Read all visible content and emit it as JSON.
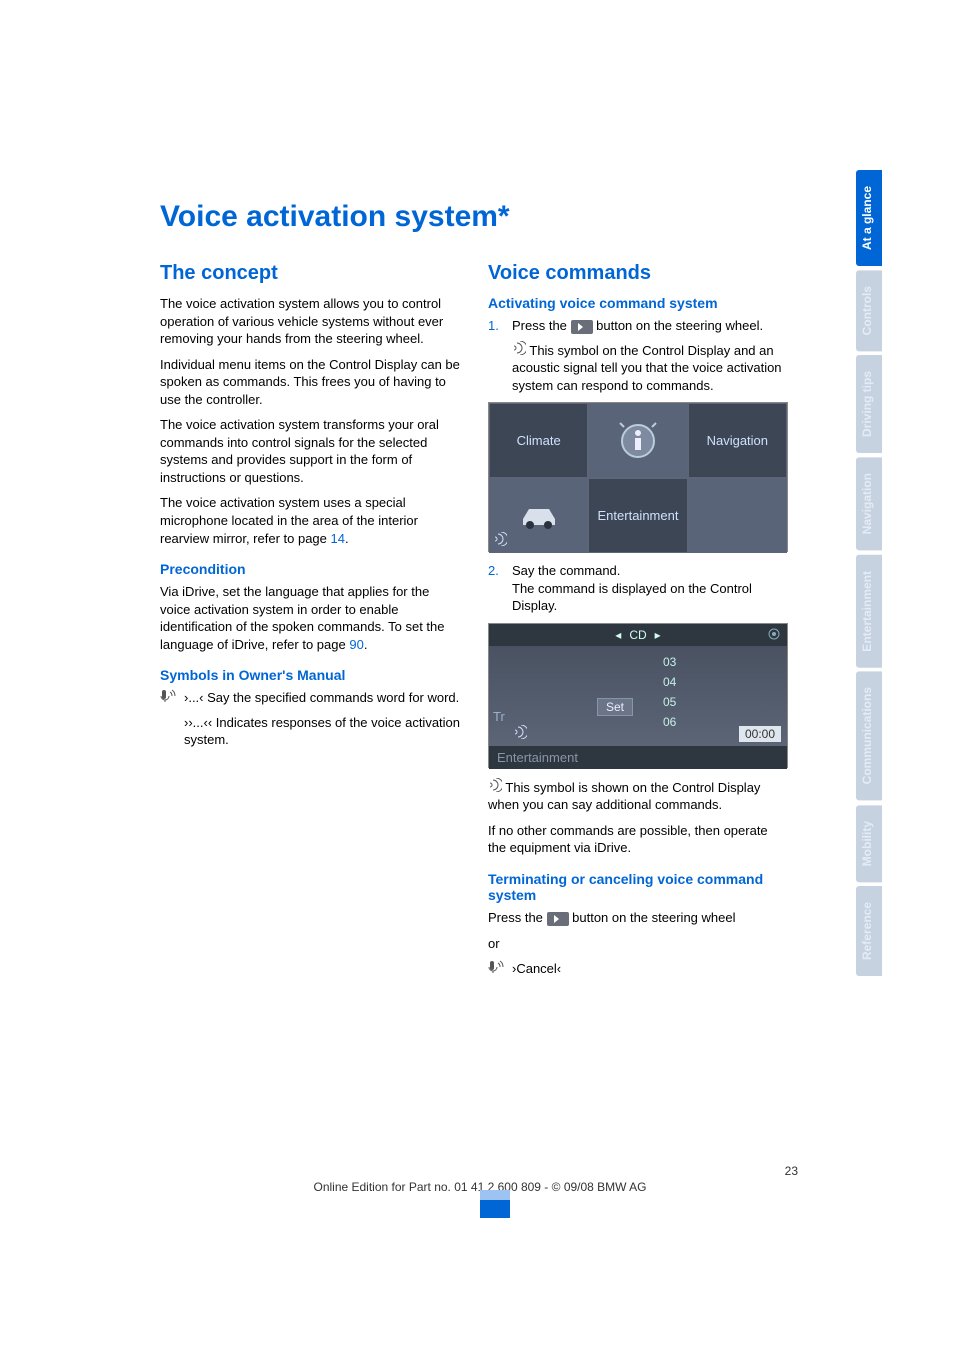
{
  "title": "Voice activation system*",
  "left": {
    "h_concept": "The concept",
    "p1": "The voice activation system allows you to control operation of various vehicle systems without ever removing your hands from the steering wheel.",
    "p2": "Individual menu items on the Control Display can be spoken as commands. This frees you of having to use the controller.",
    "p3": "The voice activation system transforms your oral commands into control signals for the selected systems and provides support in the form of instructions or questions.",
    "p4a": "The voice activation system uses a special microphone located in the area of the interior rearview mirror, refer to page ",
    "p4link": "14",
    "p4b": ".",
    "h_pre": "Precondition",
    "p5a": "Via iDrive, set the language that applies for the voice activation system in order to enable identification of the spoken commands. To set the language of iDrive, refer to page ",
    "p5link": "90",
    "p5b": ".",
    "h_sym": "Symbols in Owner's Manual",
    "sym1": "›...‹ Say the specified commands word for word.",
    "sym2": "››...‹‹ Indicates responses of the voice activation system."
  },
  "right": {
    "h_vc": "Voice commands",
    "h_act": "Activating voice command system",
    "li1a": "Press the ",
    "li1b": " button on the steering wheel.",
    "li1c": " This symbol on the Control Display and an acoustic signal tell you that the voice activation system can respond to commands.",
    "li2a": "Say the command.",
    "li2b": "The command is displayed on the Control Display.",
    "after2a": " This symbol is shown on the Control Display when you can say additional commands.",
    "after2b": "If no other commands are possible, then operate the equipment via iDrive.",
    "h_term": "Terminating or canceling voice command system",
    "term1a": "Press the ",
    "term1b": " button on the steering wheel",
    "term2": "or",
    "cancel": "›Cancel‹"
  },
  "img1": {
    "climate": "Climate",
    "nav": "Navigation",
    "ent": "Entertainment"
  },
  "img2": {
    "cd": "CD",
    "set": "Set",
    "n3": "03",
    "n4": "04",
    "n5": "05",
    "n6": "06",
    "time": "00:00",
    "tr": "Tr",
    "bottom": "Entertainment"
  },
  "tabs": [
    "At a glance",
    "Controls",
    "Driving tips",
    "Navigation",
    "Entertainment",
    "Communications",
    "Mobility",
    "Reference"
  ],
  "footer": {
    "page": "23",
    "line": "Online Edition for Part no. 01 41 2 600 809 - © 09/08 BMW AG"
  }
}
